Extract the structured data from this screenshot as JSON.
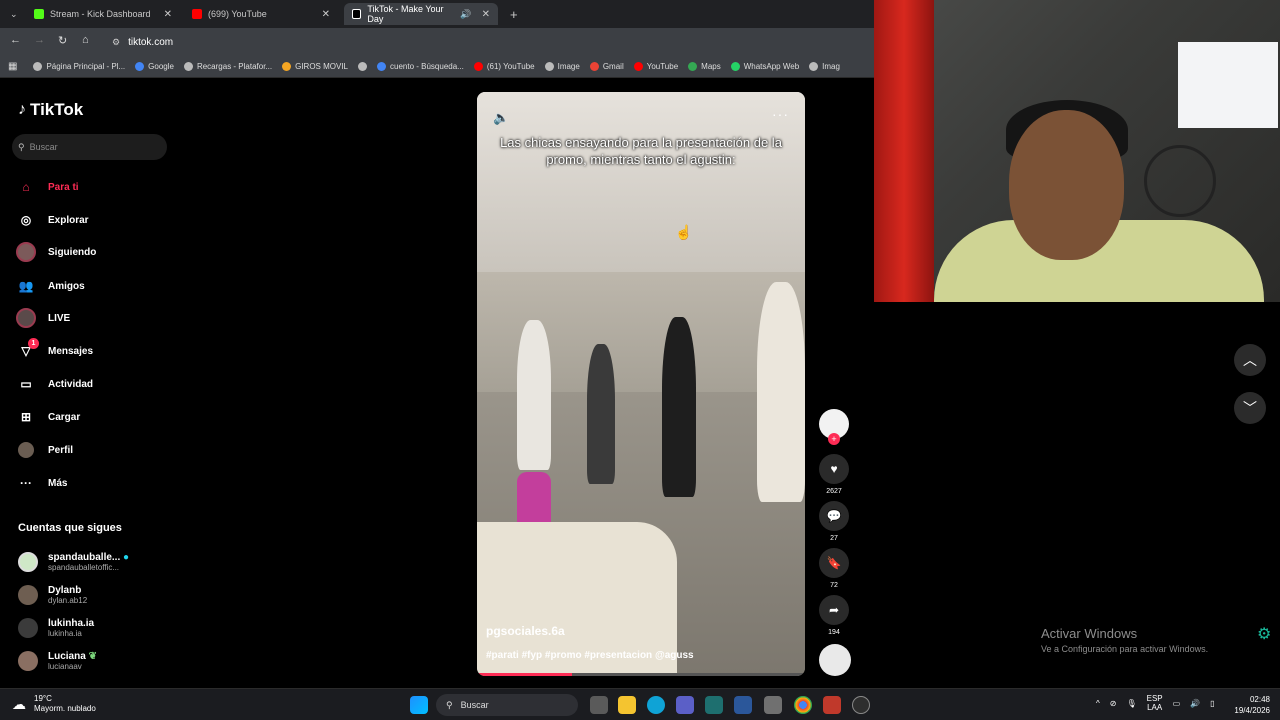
{
  "browser": {
    "tabs": [
      {
        "title": "Stream - Kick Dashboard",
        "icon": "kick-icon",
        "color": "#53fc18",
        "active": false
      },
      {
        "title": "(699) YouTube",
        "icon": "youtube-icon",
        "color": "#ff0000",
        "active": false
      },
      {
        "title": "TikTok - Make Your Day",
        "icon": "tiktok-icon",
        "color": "#ffffff",
        "active": true
      }
    ],
    "new_tab": "+",
    "address": "tiktok.com",
    "bookmarks": [
      {
        "label": "Página Principal - Pl...",
        "color": "#bbbbbb"
      },
      {
        "label": "Google",
        "color": "#4285f4"
      },
      {
        "label": "Recargas - Platafor...",
        "color": "#bbbbbb"
      },
      {
        "label": "GIROS MOVIL",
        "color": "#f5a623"
      },
      {
        "label": "",
        "color": "#bbbbbb"
      },
      {
        "label": "cuento - Búsqueda...",
        "color": "#4285f4"
      },
      {
        "label": "(61) YouTube",
        "color": "#ff0000"
      },
      {
        "label": "Image",
        "color": "#bbbbbb"
      },
      {
        "label": "Gmail",
        "color": "#ea4335"
      },
      {
        "label": "YouTube",
        "color": "#ff0000"
      },
      {
        "label": "Maps",
        "color": "#34a853"
      },
      {
        "label": "WhatsApp Web",
        "color": "#25d366"
      },
      {
        "label": "Imag",
        "color": "#bbbbbb"
      }
    ]
  },
  "tiktok": {
    "logo": "TikTok",
    "search_placeholder": "Buscar",
    "nav": [
      {
        "label": "Para ti",
        "icon": "home-icon",
        "active": true
      },
      {
        "label": "Explorar",
        "icon": "compass-icon",
        "active": false
      },
      {
        "label": "Siguiendo",
        "icon": "following-avatar-icon",
        "active": false
      },
      {
        "label": "Amigos",
        "icon": "friends-icon",
        "active": false
      },
      {
        "label": "LIVE",
        "icon": "live-icon",
        "active": false
      },
      {
        "label": "Mensajes",
        "icon": "messages-icon",
        "active": false,
        "badge": "1"
      },
      {
        "label": "Actividad",
        "icon": "activity-icon",
        "active": false
      },
      {
        "label": "Cargar",
        "icon": "upload-icon",
        "active": false
      },
      {
        "label": "Perfil",
        "icon": "profile-icon",
        "active": false
      },
      {
        "label": "Más",
        "icon": "more-icon",
        "active": false
      }
    ],
    "following_title": "Cuentas que sigues",
    "following": [
      {
        "name": "spandauballe...",
        "handle": "spandauballetoffic...",
        "verified": true
      },
      {
        "name": "Dylanb",
        "handle": "dylan.ab12",
        "verified": false
      },
      {
        "name": "lukinha.ia",
        "handle": "lukinha.ia",
        "verified": false
      },
      {
        "name": "Luciana",
        "handle": "lucianaav",
        "verified": false
      }
    ],
    "video": {
      "caption": "Las chicas ensayando para la presentación de la promo, mientras tanto el agustin:",
      "author": "pgsociales.6a",
      "tags": "#parati #fyp #promo #presentacion @aguss",
      "progress": 0.29
    },
    "actions": {
      "likes": "2627",
      "comments": "27",
      "saves": "72",
      "shares": "194"
    }
  },
  "watermark": {
    "line1": "Activar Windows",
    "line2": "Ve a Configuración para activar Windows."
  },
  "taskbar": {
    "weather_temp": "19°C",
    "weather_desc": "Mayorm. nublado",
    "search": "Buscar",
    "lang_1": "ESP",
    "lang_2": "LAA",
    "time": "02:48",
    "date": "19/4/2026"
  }
}
